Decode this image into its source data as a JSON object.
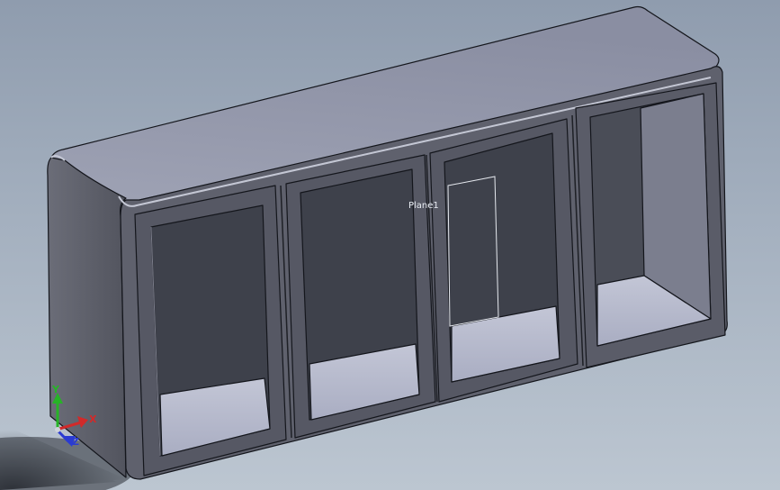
{
  "viewport": {
    "background_top": "#8f9cae",
    "background_bottom": "#bcc6d1"
  },
  "model": {
    "plane_label": "Plane1",
    "body_color_top": "#a0a3b3",
    "body_color_front": "#5e606c",
    "opening_color": "#3f424c",
    "floor_color": "#b4b8cb"
  },
  "triad": {
    "x_label": "X",
    "y_label": "Y",
    "z_label": "Z",
    "x_color": "#d12a2a",
    "y_color": "#27b327",
    "z_color": "#2a3bd1"
  }
}
